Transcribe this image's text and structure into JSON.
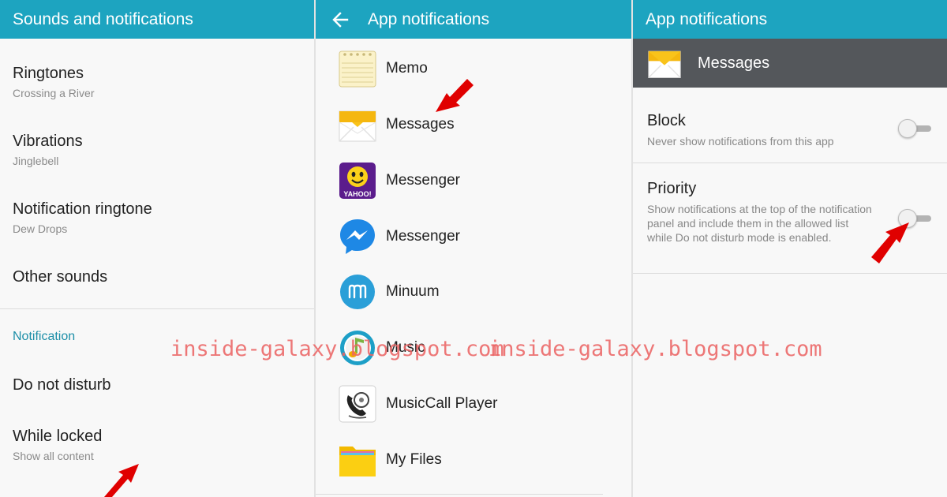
{
  "panel1": {
    "title": "Sounds and notifications",
    "items": [
      {
        "title": "Ringtones",
        "subtitle": "Crossing a River"
      },
      {
        "title": "Vibrations",
        "subtitle": "Jinglebell"
      },
      {
        "title": "Notification ringtone",
        "subtitle": "Dew Drops"
      },
      {
        "title": "Other sounds",
        "subtitle": ""
      }
    ],
    "category": "Notification",
    "items2": [
      {
        "title": "Do not disturb",
        "subtitle": ""
      },
      {
        "title": "While locked",
        "subtitle": "Show all content"
      }
    ]
  },
  "panel2": {
    "title": "App notifications",
    "apps": [
      {
        "name": "Memo",
        "icon": "memo-icon"
      },
      {
        "name": "Messages",
        "icon": "messages-icon"
      },
      {
        "name": "Messenger",
        "icon": "yahoo-messenger-icon"
      },
      {
        "name": "Messenger",
        "icon": "facebook-messenger-icon"
      },
      {
        "name": "Minuum",
        "icon": "minuum-icon"
      },
      {
        "name": "Music",
        "icon": "music-icon"
      },
      {
        "name": "MusicCall Player",
        "icon": "musiccall-player-icon"
      },
      {
        "name": "My Files",
        "icon": "folder-icon"
      }
    ],
    "yahoo_text": "YAHOO!"
  },
  "panel3": {
    "title": "App notifications",
    "app_name": "Messages",
    "block": {
      "title": "Block",
      "desc": "Never show notifications from this app",
      "on": false
    },
    "priority": {
      "title": "Priority",
      "desc": "Show notifications at the top of the notification panel and include them in the allowed list while Do not disturb mode is enabled.",
      "on": false
    }
  },
  "watermark": "inside-galaxy.blogspot.com",
  "colors": {
    "appbar": "#1da4c0",
    "category": "#1d8fa8",
    "header": "#54575b",
    "arrow": "#e00000"
  }
}
